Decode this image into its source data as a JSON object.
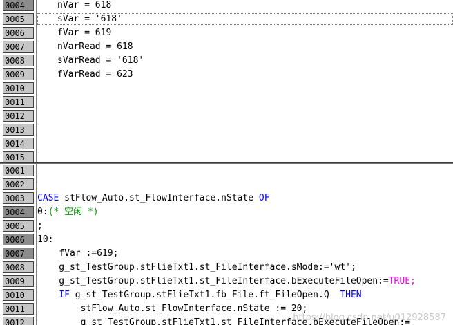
{
  "watch": {
    "lines": [
      {
        "num": "0004",
        "text": "nVar = 618"
      },
      {
        "num": "0005",
        "text": "sVar = '618'"
      },
      {
        "num": "0006",
        "text": "fVar = 619"
      },
      {
        "num": "0007",
        "text": "nVarRead = 618"
      },
      {
        "num": "0008",
        "text": "sVarRead = '618'"
      },
      {
        "num": "0009",
        "text": "fVarRead = 623"
      },
      {
        "num": "0010",
        "text": ""
      },
      {
        "num": "0011",
        "text": ""
      },
      {
        "num": "0012",
        "text": ""
      },
      {
        "num": "0013",
        "text": ""
      },
      {
        "num": "0014",
        "text": ""
      },
      {
        "num": "0015",
        "text": ""
      }
    ]
  },
  "code": {
    "line_numbers": [
      "0001",
      "0002",
      "0003",
      "0004",
      "0005",
      "0006",
      "0007",
      "0008",
      "0009",
      "0010",
      "0011",
      "0012"
    ],
    "l3_kw1": "CASE",
    "l3_expr": " stFlow_Auto.st_FlowInterface.nState ",
    "l3_kw2": "OF",
    "l4_label": "0:",
    "l4_comment": "(* 空闲 *)",
    "l5": ";",
    "l6": "10:",
    "l7": "    fVar :=619;",
    "l8": "    g_st_TestGroup.stFlieTxt1.st_FileInterface.sMode:='wt';",
    "l9_code": "    g_st_TestGroup.stFlieTxt1.st_FileInterface.bExecuteFileOpen:=",
    "l9_true": "TRUE;",
    "l10_indent": "    ",
    "l10_kw1": "IF",
    "l10_expr": " g_st_TestGroup.stFlieTxt1.fb_File.ft_FileOpen.Q  ",
    "l10_kw2": "THEN",
    "l11": "        stFlow_Auto.st_FlowInterface.nState := 20;",
    "l12": "        g_st_TestGroup.stFlieTxt1.st_FileInterface.bExecuteFileOpen:=",
    "watermark": "https://blog.csdn.net/u012928587"
  },
  "colors": {
    "keyword": "#0000ff",
    "comment": "#00a000",
    "constant": "#ff00ff"
  }
}
